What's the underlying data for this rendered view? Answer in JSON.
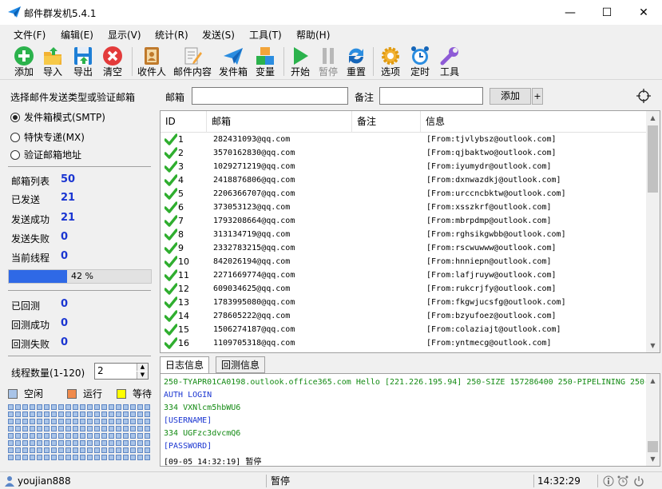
{
  "window": {
    "title": "邮件群发机5.4.1",
    "minimize": "—",
    "maximize": "☐",
    "close": "✕"
  },
  "menu": [
    "文件(F)",
    "编辑(E)",
    "显示(V)",
    "统计(R)",
    "发送(S)",
    "工具(T)",
    "帮助(H)"
  ],
  "toolbar": {
    "add": "添加",
    "import": "导入",
    "export": "导出",
    "clear": "清空",
    "recipients": "收件人",
    "content": "邮件内容",
    "senders": "发件箱",
    "variables": "变量",
    "start": "开始",
    "pause": "暂停",
    "reset": "重置",
    "options": "选项",
    "timer": "定时",
    "tools": "工具"
  },
  "left": {
    "heading": "选择邮件发送类型或验证邮箱",
    "modes": [
      "发件箱模式(SMTP)",
      "特快专递(MX)",
      "验证邮箱地址"
    ],
    "selected_mode": 0,
    "stats": [
      {
        "label": "邮箱列表",
        "value": "50"
      },
      {
        "label": "已发送",
        "value": "21"
      },
      {
        "label": "发送成功",
        "value": "21"
      },
      {
        "label": "发送失败",
        "value": "0"
      },
      {
        "label": "当前线程",
        "value": "0"
      }
    ],
    "progress": {
      "percent": 42,
      "text": "42 %"
    },
    "bounce": [
      {
        "label": "已回测",
        "value": "0"
      },
      {
        "label": "回测成功",
        "value": "0"
      },
      {
        "label": "回测失败",
        "value": "0"
      }
    ],
    "thread_label": "线程数量(1-120)",
    "thread_value": "2",
    "legend": [
      {
        "label": "空闲",
        "color": "#a9c4e8"
      },
      {
        "label": "运行",
        "color": "#f08a4b"
      },
      {
        "label": "等待",
        "color": "#ffff00"
      }
    ]
  },
  "search": {
    "email_label": "邮箱",
    "email_value": "",
    "note_label": "备注",
    "note_value": "",
    "add_label": "添加",
    "plus": "+"
  },
  "table": {
    "columns": [
      "ID",
      "邮箱",
      "备注",
      "信息"
    ],
    "rows": [
      {
        "id": "1",
        "email": "282431093@qq.com",
        "note": "",
        "info": "[From:tjvlybsz@outlook.com]"
      },
      {
        "id": "2",
        "email": "3570162830@qq.com",
        "note": "",
        "info": "[From:qjbaktwo@outlook.com]"
      },
      {
        "id": "3",
        "email": "1029271219@qq.com",
        "note": "",
        "info": "[From:iyumydr@outlook.com]"
      },
      {
        "id": "4",
        "email": "2418876806@qq.com",
        "note": "",
        "info": "[From:dxnwazdkj@outlook.com]"
      },
      {
        "id": "5",
        "email": "2206366707@qq.com",
        "note": "",
        "info": "[From:urccncbktw@outlook.com]"
      },
      {
        "id": "6",
        "email": "373053123@qq.com",
        "note": "",
        "info": "[From:xsszkrf@outlook.com]"
      },
      {
        "id": "7",
        "email": "1793208664@qq.com",
        "note": "",
        "info": "[From:mbrpdmp@outlook.com]"
      },
      {
        "id": "8",
        "email": "313134719@qq.com",
        "note": "",
        "info": "[From:rghsikgwbb@outlook.com]"
      },
      {
        "id": "9",
        "email": "2332783215@qq.com",
        "note": "",
        "info": "[From:rscwuwww@outlook.com]"
      },
      {
        "id": "10",
        "email": "842026194@qq.com",
        "note": "",
        "info": "[From:hnniepn@outlook.com]"
      },
      {
        "id": "11",
        "email": "2271669774@qq.com",
        "note": "",
        "info": "[From:lafjruyw@outlook.com]"
      },
      {
        "id": "12",
        "email": "609034625@qq.com",
        "note": "",
        "info": "[From:rukcrjfy@outlook.com]"
      },
      {
        "id": "13",
        "email": "1783995080@qq.com",
        "note": "",
        "info": "[From:fkgwjucsfg@outlook.com]"
      },
      {
        "id": "14",
        "email": "278605222@qq.com",
        "note": "",
        "info": "[From:bzyufoez@outlook.com]"
      },
      {
        "id": "15",
        "email": "1506274187@qq.com",
        "note": "",
        "info": "[From:colaziajt@outlook.com]"
      },
      {
        "id": "16",
        "email": "1109705318@qq.com",
        "note": "",
        "info": "[From:yntmecg@outlook.com]"
      }
    ]
  },
  "log_tabs": [
    "日志信息",
    "回测信息"
  ],
  "log": [
    {
      "text": "250-TYAPR01CA0198.outlook.office365.com Hello [221.226.195.94] 250-SIZE 157286400 250-PIPELINING 250-",
      "color": "#138a13"
    },
    {
      "text": "AUTH LOGIN",
      "color": "#1a35d1"
    },
    {
      "text": "334 VXNlcm5hbWU6",
      "color": "#138a13"
    },
    {
      "text": "[USERNAME]",
      "color": "#1a35d1"
    },
    {
      "text": "334 UGFzc3dvcmQ6",
      "color": "#138a13"
    },
    {
      "text": "[PASSWORD]",
      "color": "#1a35d1"
    },
    {
      "text": "[09-05 14:32:19] 暂停",
      "color": "#000000"
    }
  ],
  "status": {
    "user": "youjian888",
    "state": "暂停",
    "time": "14:32:29"
  }
}
